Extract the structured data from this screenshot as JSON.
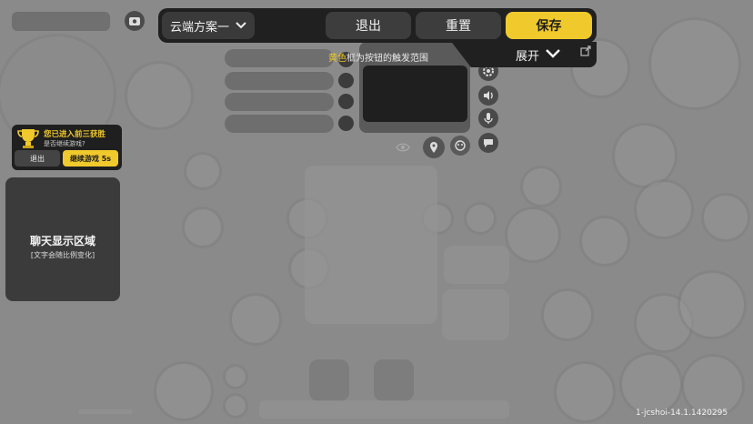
{
  "toolbar": {
    "scheme_label": "云端方案一",
    "exit_label": "退出",
    "reset_label": "重置",
    "save_label": "保存",
    "expand_label": "展开",
    "hint_highlight": "黄色",
    "hint_rest": "框为按钮的触发范围"
  },
  "victory": {
    "title": "您已进入前三获胜",
    "subtitle": "是否继续游戏?",
    "exit_label": "退出",
    "continue_label": "继续游戏 5s"
  },
  "chat": {
    "title": "聊天显示区域",
    "subtitle": "[文字会随比例变化]"
  },
  "version": "1-jcshoi-14.1.1420295",
  "colors": {
    "accent": "#f0c92d",
    "toolbar_bg": "#202020",
    "button_bg": "#3d3d3d"
  },
  "icons": [
    "camera-switch-icon",
    "chevron-down-icon",
    "gear-icon",
    "speaker-icon",
    "microphone-icon",
    "chat-bubble-icon",
    "location-pin-icon",
    "eye-icon",
    "emote-icon",
    "trophy-icon",
    "share-icon"
  ]
}
